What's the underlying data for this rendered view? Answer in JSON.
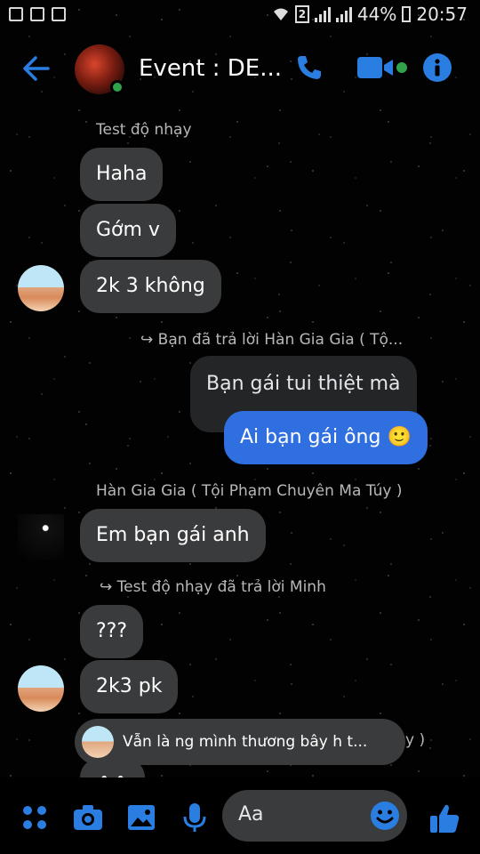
{
  "status_bar": {
    "battery": "44%",
    "time": "20:57",
    "sim_slot": "2"
  },
  "header": {
    "title": "Event : DE...",
    "icons": [
      "back-arrow-icon",
      "phone-icon",
      "video-icon",
      "info-icon"
    ]
  },
  "messages": [
    {
      "sender": "Test độ nhạy",
      "bubbles": [
        "Haha",
        "Gớm v",
        "2k 3 không"
      ]
    },
    {
      "reply_note": "Bạn đã trả lời Hàn Gia Gia ( Tộ...",
      "bubbles": [
        "Bạn gái tui thiệt mà",
        "Ai bạn gái ông 🙂"
      ]
    },
    {
      "sender": "Hàn Gia Gia ( Tội Phạm Chuyên Ma Túy )",
      "bubbles": [
        "Em bạn gái anh"
      ]
    },
    {
      "reply_note": "Test độ nhạy đã trả lời Minh",
      "bubbles": [
        "???",
        "2k3 pk",
        "^^"
      ]
    }
  ],
  "reply_preview": "Vẫn là ng mình thương bây h t...",
  "reply_preview_tail": "y )",
  "composer": {
    "placeholder": "Aa"
  },
  "colors": {
    "accent": "#2a7de1",
    "own_bubble": "#2f6fe0",
    "other_bubble": "#3a3b3c",
    "online": "#31a24c"
  }
}
